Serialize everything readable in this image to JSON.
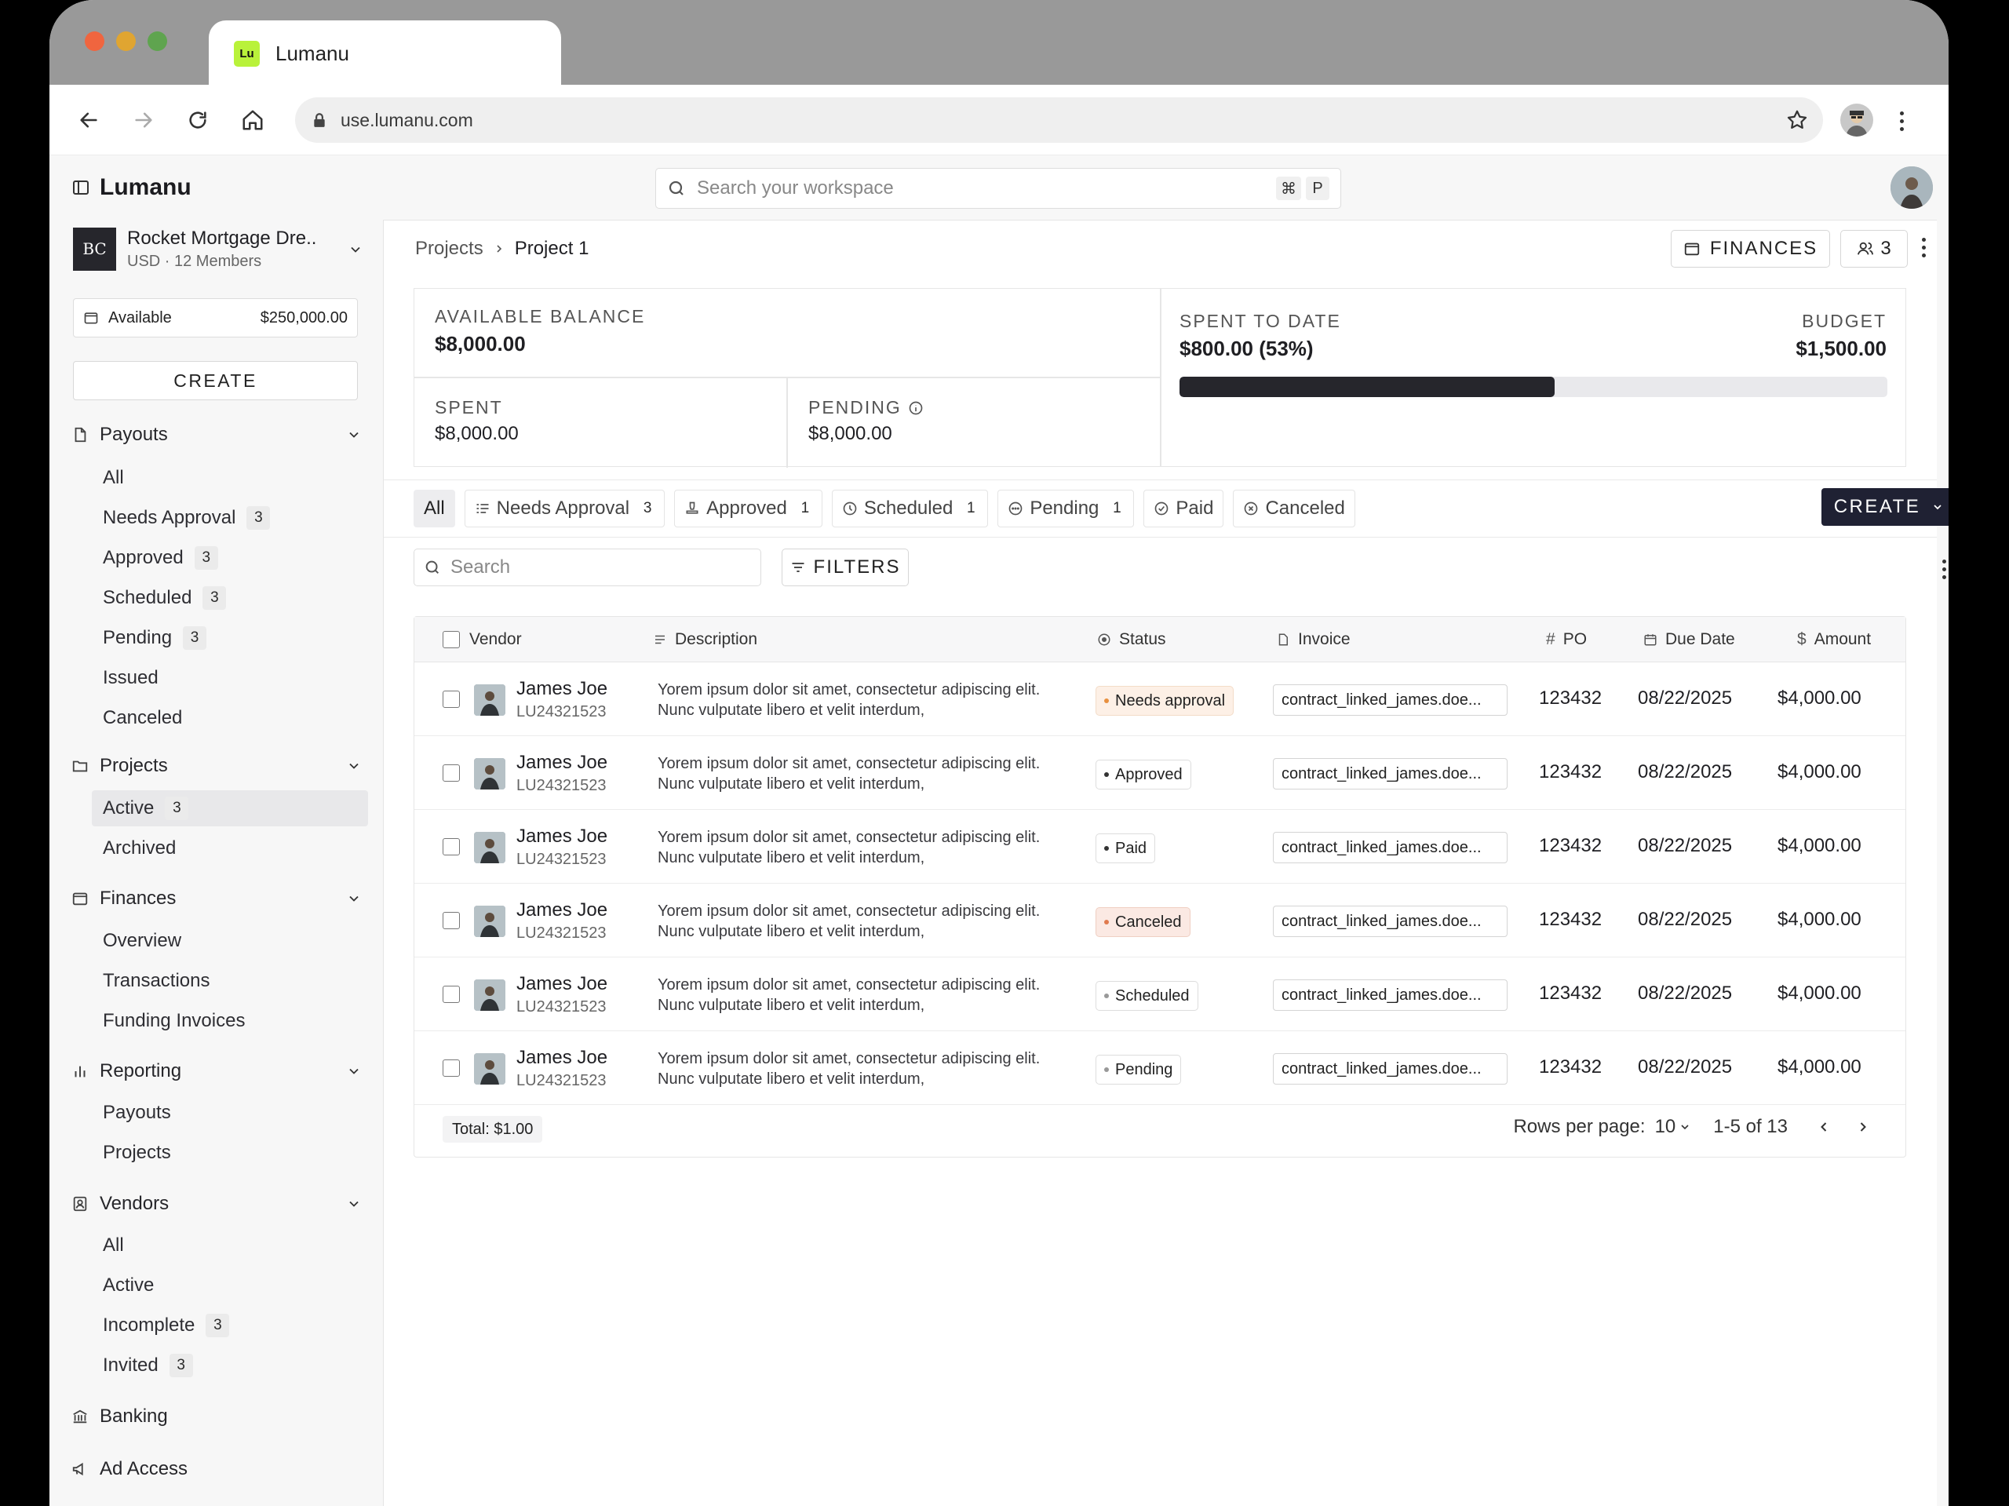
{
  "browser": {
    "tab_title": "Lumanu",
    "tab_logo": "Lu",
    "url": "use.lumanu.com"
  },
  "brand": "Lumanu",
  "org": {
    "badge": "BC",
    "name": "Rocket Mortgage Dre..",
    "sub": "USD · 12 Members"
  },
  "available": {
    "label": "Available",
    "amount": "$250,000.00"
  },
  "sidebar_create": "CREATE",
  "sidebar": {
    "payouts": {
      "label": "Payouts",
      "items": [
        {
          "label": "All",
          "count": ""
        },
        {
          "label": "Needs Approval",
          "count": "3"
        },
        {
          "label": "Approved",
          "count": "3"
        },
        {
          "label": "Scheduled",
          "count": "3"
        },
        {
          "label": "Pending",
          "count": "3"
        },
        {
          "label": "Issued",
          "count": ""
        },
        {
          "label": "Canceled",
          "count": ""
        }
      ]
    },
    "projects": {
      "label": "Projects",
      "items": [
        {
          "label": "Active",
          "count": "3"
        },
        {
          "label": "Archived",
          "count": ""
        }
      ]
    },
    "finances": {
      "label": "Finances",
      "items": [
        {
          "label": "Overview"
        },
        {
          "label": "Transactions"
        },
        {
          "label": "Funding Invoices"
        }
      ]
    },
    "reporting": {
      "label": "Reporting",
      "items": [
        {
          "label": "Payouts"
        },
        {
          "label": "Projects"
        }
      ]
    },
    "vendors": {
      "label": "Vendors",
      "items": [
        {
          "label": "All",
          "count": ""
        },
        {
          "label": "Active",
          "count": ""
        },
        {
          "label": "Incomplete",
          "count": "3"
        },
        {
          "label": "Invited",
          "count": "3"
        }
      ]
    },
    "banking": "Banking",
    "ad_access": "Ad Access"
  },
  "search": {
    "placeholder": "Search your workspace",
    "kbd1": "⌘",
    "kbd2": "P"
  },
  "breadcrumb": {
    "parent": "Projects",
    "current": "Project 1"
  },
  "header": {
    "finances_button": "FINANCES",
    "members_count": "3"
  },
  "stats": {
    "available_label": "AVAILABLE BALANCE",
    "available_value": "$8,000.00",
    "spent_label": "SPENT",
    "spent_value": "$8,000.00",
    "pending_label": "PENDING",
    "pending_value": "$8,000.00",
    "spent_to_date_label": "SPENT TO DATE",
    "spent_to_date_value": "$800.00 (53%)",
    "budget_label": "BUDGET",
    "budget_value": "$1,500.00",
    "progress_fraction": 0.53
  },
  "tabs": [
    {
      "label": "All",
      "count": ""
    },
    {
      "label": "Needs Approval",
      "count": "3"
    },
    {
      "label": "Approved",
      "count": "1"
    },
    {
      "label": "Scheduled",
      "count": "1"
    },
    {
      "label": "Pending",
      "count": "1"
    },
    {
      "label": "Paid",
      "count": ""
    },
    {
      "label": "Canceled",
      "count": ""
    }
  ],
  "create_button": "CREATE",
  "table_search_placeholder": "Search",
  "filters_button": "FILTERS",
  "columns": {
    "vendor": "Vendor",
    "description": "Description",
    "status": "Status",
    "invoice": "Invoice",
    "po": "PO",
    "due": "Due Date",
    "amount": "Amount"
  },
  "rows": [
    {
      "name": "James Joe",
      "id": "LU24321523",
      "desc": "Yorem ipsum dolor sit amet, consectetur adipiscing elit. Nunc vulputate libero et velit interdum,",
      "status": "Needs approval",
      "invoice": "contract_linked_james.doe...",
      "po": "123432",
      "due": "08/22/2025",
      "amount": "$4,000.00"
    },
    {
      "name": "James Joe",
      "id": "LU24321523",
      "desc": "Yorem ipsum dolor sit amet, consectetur adipiscing elit. Nunc vulputate libero et velit interdum,",
      "status": "Approved",
      "invoice": "contract_linked_james.doe...",
      "po": "123432",
      "due": "08/22/2025",
      "amount": "$4,000.00"
    },
    {
      "name": "James Joe",
      "id": "LU24321523",
      "desc": "Yorem ipsum dolor sit amet, consectetur adipiscing elit. Nunc vulputate libero et velit interdum,",
      "status": "Paid",
      "invoice": "contract_linked_james.doe...",
      "po": "123432",
      "due": "08/22/2025",
      "amount": "$4,000.00"
    },
    {
      "name": "James Joe",
      "id": "LU24321523",
      "desc": "Yorem ipsum dolor sit amet, consectetur adipiscing elit. Nunc vulputate libero et velit interdum,",
      "status": "Canceled",
      "invoice": "contract_linked_james.doe...",
      "po": "123432",
      "due": "08/22/2025",
      "amount": "$4,000.00"
    },
    {
      "name": "James Joe",
      "id": "LU24321523",
      "desc": "Yorem ipsum dolor sit amet, consectetur adipiscing elit. Nunc vulputate libero et velit interdum,",
      "status": "Scheduled",
      "invoice": "contract_linked_james.doe...",
      "po": "123432",
      "due": "08/22/2025",
      "amount": "$4,000.00"
    },
    {
      "name": "James Joe",
      "id": "LU24321523",
      "desc": "Yorem ipsum dolor sit amet, consectetur adipiscing elit. Nunc vulputate libero et velit interdum,",
      "status": "Pending",
      "invoice": "contract_linked_james.doe...",
      "po": "123432",
      "due": "08/22/2025",
      "amount": "$4,000.00"
    }
  ],
  "footer": {
    "total": "Total: $1.00",
    "rows_per_page_label": "Rows per page:",
    "rows_per_page": "10",
    "range": "1-5 of 13"
  },
  "colors": {
    "accent": "#1f2133",
    "warn": "#e8903f",
    "cancel": "#e07a4e",
    "logo": "#b9f23a"
  }
}
